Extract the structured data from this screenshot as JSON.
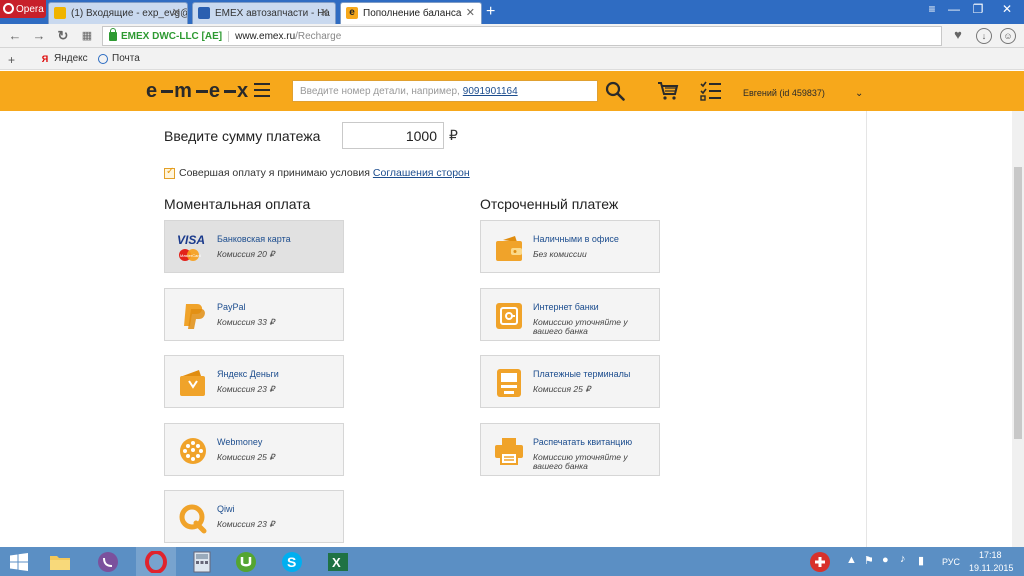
{
  "browser": {
    "menu_label": "Opera",
    "tabs": [
      {
        "title": "(1) Входящие - exp_evg@"
      },
      {
        "title": "EMEX автозапчасти - Нa"
      },
      {
        "title": "Пополнение баланса"
      }
    ],
    "ev_name": "EMEX DWC-LLC [AE]",
    "url_host": "www.emex.ru",
    "url_path": "/Recharge",
    "bookmarks": [
      {
        "label": "Яндекс",
        "icon": "yandex-icon"
      },
      {
        "label": "Почта",
        "icon": "mail-icon"
      }
    ]
  },
  "site": {
    "search_placeholder": "Введите номер детали, например,",
    "search_sample": "9091901164",
    "user": "Евгений  (id 459837)"
  },
  "form": {
    "amount_label": "Введите сумму платежа",
    "amount_value": "1000",
    "currency": "₽",
    "agree_text": "Совершая оплату я принимаю условия",
    "agree_link": "Соглашения сторон"
  },
  "instant": {
    "title": "Моментальная оплата",
    "methods": [
      {
        "name": "Банковская карта",
        "fee": "Комиссия 20 ₽",
        "icon": "visa-mastercard-icon"
      },
      {
        "name": "PayPal",
        "fee": "Комиссия 33 ₽",
        "icon": "paypal-icon"
      },
      {
        "name": "Яндекс Деньги",
        "fee": "Комиссия 23 ₽",
        "icon": "wallet-icon"
      },
      {
        "name": "Webmoney",
        "fee": "Комиссия 25 ₽",
        "icon": "webmoney-icon"
      },
      {
        "name": "Qiwi",
        "fee": "Комиссия 23 ₽",
        "icon": "qiwi-icon"
      }
    ]
  },
  "deferred": {
    "title": "Отсроченный платеж",
    "methods": [
      {
        "name": "Наличными в офисе",
        "fee": "Без комиссии",
        "icon": "cash-wallet-icon"
      },
      {
        "name": "Интернет банки",
        "fee": "Комиссию уточняйте у вашего банка",
        "icon": "safe-icon"
      },
      {
        "name": "Платежные терминалы",
        "fee": "Комиссия 25 ₽",
        "icon": "terminal-icon"
      },
      {
        "name": "Распечатать квитанцию",
        "fee": "Комиссию уточняйте у вашего банка",
        "icon": "printer-icon"
      }
    ]
  },
  "taskbar": {
    "lang": "РУС",
    "time": "17:18",
    "date": "19.11.2015"
  },
  "colors": {
    "brand_orange": "#f7a81b",
    "icon_orange": "#f0a32a",
    "link_blue": "#1c4d8e",
    "taskbar_blue": "#5b8fc4"
  }
}
